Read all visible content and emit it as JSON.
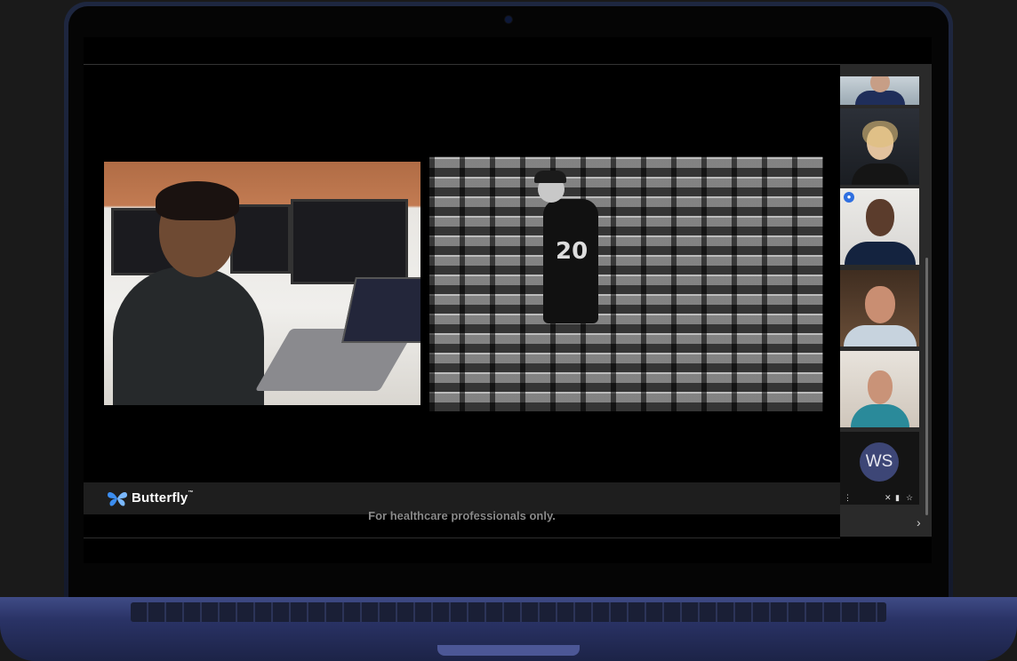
{
  "brand": {
    "name": "Butterfly",
    "trademark": "™",
    "logo_icon": "butterfly-icon",
    "logo_color": "#3b8df0"
  },
  "disclaimer": "For healthcare professionals only.",
  "videos": {
    "left_label": "presenter with laptop",
    "right_label": "arena fan",
    "right_jersey_number": "20"
  },
  "sidebar": {
    "participants": [
      {
        "kind": "video"
      },
      {
        "kind": "video"
      },
      {
        "kind": "video",
        "speaking": true
      },
      {
        "kind": "video"
      },
      {
        "kind": "video"
      },
      {
        "kind": "avatar",
        "initials": "WS"
      }
    ],
    "icons": {
      "more": "⋮",
      "mute": "🎤",
      "camera": "▮",
      "star": "☆",
      "next": "›"
    }
  },
  "colors": {
    "screen_bg": "#000000",
    "bar_bg": "#1e1e1e",
    "sidebar_bg": "#2a2a2a",
    "avatar_bg": "#3d4676",
    "laptop_body": "#2a3366"
  }
}
